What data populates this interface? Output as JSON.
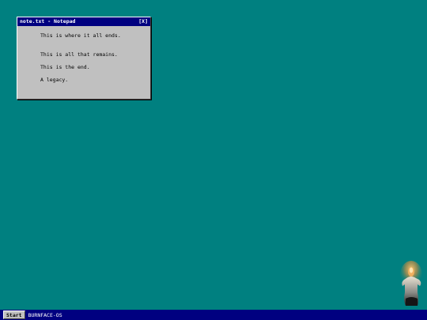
{
  "desktop": {
    "background_color": "#008080"
  },
  "window": {
    "title": "note.txt - Notepad",
    "close_label": "[X]",
    "lines": [
      "This is where it all ends.",
      "This is all that remains.",
      "This is the end.",
      "A legacy."
    ],
    "titlebar_color": "#000080",
    "body_color": "#c0c0c0"
  },
  "taskbar": {
    "start_label": "Start",
    "os_label": "BURNFACE-OS",
    "color": "#000080"
  },
  "desktop_figure": {
    "icon": "burning-figure-icon"
  }
}
